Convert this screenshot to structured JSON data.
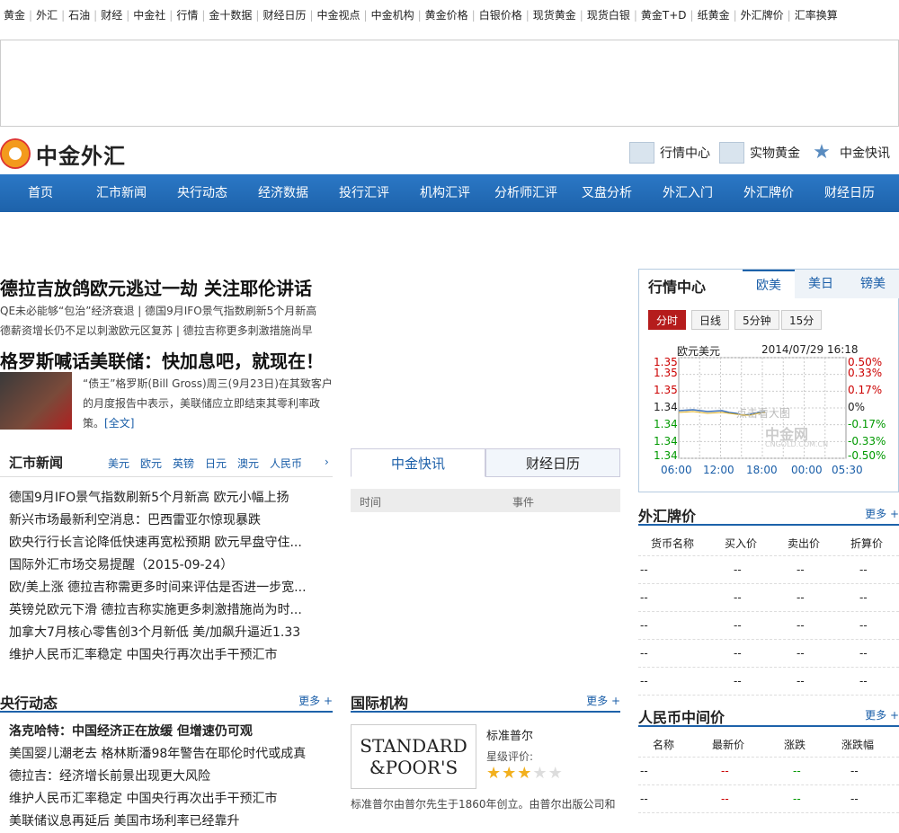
{
  "topnav": [
    "黄金",
    "外汇",
    "石油",
    "财经",
    "中金社",
    "行情",
    "金十数据",
    "财经日历",
    "中金视点",
    "中金机构",
    "黄金价格",
    "白银价格",
    "现货黄金",
    "现货白银",
    "黄金T+D",
    "纸黄金",
    "外汇牌价",
    "汇率换算"
  ],
  "logo": {
    "text": "中金外汇"
  },
  "toplinks": [
    "行情中心",
    "实物黄金",
    "中金快讯"
  ],
  "mainnav": [
    "首页",
    "汇市新闻",
    "央行动态",
    "经济数据",
    "投行汇评",
    "机构汇评",
    "分析师汇评",
    "叉盘分析",
    "外汇入门",
    "外汇牌价",
    "财经日历"
  ],
  "headline1": "德拉吉放鸽欧元逃过一劫 关注耶伦讲话",
  "sub1a": "QE未必能够“包治”经济衰退 | 德国9月IFO景气指数刷新5个月新高",
  "sub1b": "德薪资增长仍不足以刺激欧元区复苏 | 德拉吉称更多刺激措施尚早",
  "headline2": "格罗斯喊话美联储：快加息吧，就现在！",
  "gross_text": "“债王”格罗斯(Bill Gross)周三(9月23日)在其致客户的月度报告中表示，美联储应立即结束其零利率政策。",
  "gross_more": "[全文]",
  "fxnews": {
    "title": "汇市新闻",
    "currencies": [
      "美元",
      "欧元",
      "英镑",
      "日元",
      "澳元",
      "人民币"
    ],
    "items": [
      "德国9月IFO景气指数刷新5个月新高 欧元小幅上扬",
      "新兴市场最新利空消息：巴西雷亚尔惊现暴跌",
      "欧央行行长言论降低快速再宽松预期 欧元早盘守住...",
      "国际外汇市场交易提醒（2015-09-24）",
      "欧/美上涨 德拉吉称需更多时间来评估是否进一步宽...",
      "英镑兑欧元下滑 德拉吉称实施更多刺激措施尚为时...",
      "加拿大7月核心零售创3个月新低 美/加飙升逼近1.33",
      "维护人民币汇率稳定 中国央行再次出手干预汇市"
    ]
  },
  "kx": {
    "tab1": "中金快讯",
    "tab2": "财经日历",
    "col1": "时间",
    "col2": "事件"
  },
  "central": {
    "title": "央行动态",
    "more": "更多 +",
    "items": [
      "洛克哈特：中国经济正在放缓 但增速仍可观",
      "美国婴儿潮老去 格林斯潘98年警告在耶伦时代或成真",
      "德拉吉：经济增长前景出现更大风险",
      "维护人民币汇率稳定 中国央行再次出手干预汇市",
      "美联储议息再延后 美国市场利率已经靠升"
    ]
  },
  "intl": {
    "title": "国际机构",
    "more": "更多 +",
    "logo_line1": "STANDARD",
    "logo_line2": "&POOR'S",
    "name": "标准普尔",
    "rating_label": "星级评价:",
    "stars": 3,
    "desc": "标准普尔由普尔先生于1860年创立。由普尔出版公司和"
  },
  "market": {
    "title": "行情中心",
    "tabs": [
      "欧美",
      "美日",
      "镑美"
    ],
    "buttons": [
      "分时",
      "日线",
      "5分钟",
      "15分"
    ],
    "pair": "欧元美元",
    "datetime": "2014/07/29 16:18",
    "watermark": "点击看大图",
    "brand": "中金网",
    "brand_url": "CNGOLD.COM.CN",
    "yleft": [
      "1.35",
      "1.35",
      "1.35",
      "1.34",
      "1.34",
      "1.34",
      "1.34"
    ],
    "yright": [
      "0.50%",
      "0.33%",
      "0.17%",
      "0%",
      "-0.17%",
      "-0.33%",
      "-0.50%"
    ],
    "xticks": [
      "06:00",
      "12:00",
      "18:00",
      "00:00",
      "05:30"
    ]
  },
  "fxrate": {
    "title": "外汇牌价",
    "more": "更多 +",
    "headers": [
      "货币名称",
      "买入价",
      "卖出价",
      "折算价"
    ],
    "rows": [
      [
        "--",
        "--",
        "--",
        "--"
      ],
      [
        "--",
        "--",
        "--",
        "--"
      ],
      [
        "--",
        "--",
        "--",
        "--"
      ],
      [
        "--",
        "--",
        "--",
        "--"
      ],
      [
        "--",
        "--",
        "--",
        "--"
      ]
    ]
  },
  "rmb": {
    "title": "人民币中间价",
    "more": "更多 +",
    "headers": [
      "名称",
      "最新价",
      "涨跌",
      "涨跌幅"
    ],
    "rows": [
      [
        "--",
        "--",
        "--",
        "--"
      ],
      [
        "--",
        "--",
        "--",
        "--"
      ]
    ]
  },
  "colors": {
    "nav_blue": "#1d62aa",
    "red": "#cc0000",
    "green": "#009900"
  }
}
